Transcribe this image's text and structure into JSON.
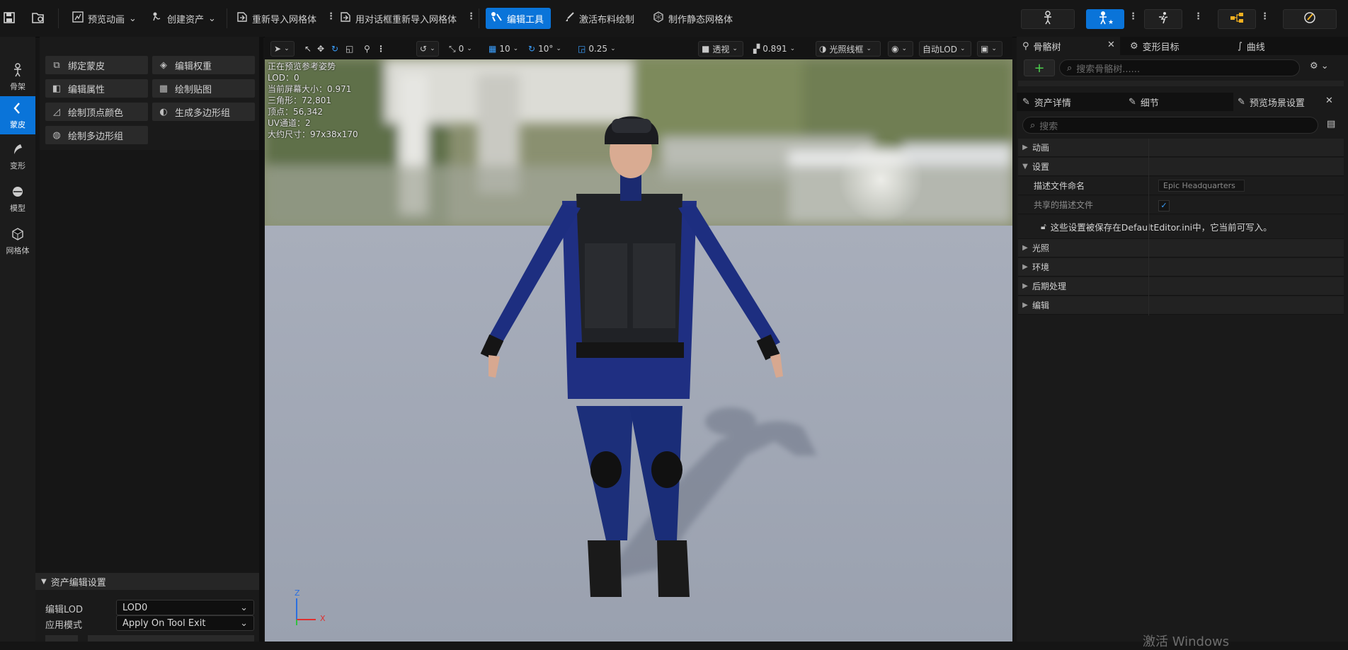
{
  "toolbar": {
    "preview_anim": "预览动画",
    "create_asset": "创建资产",
    "reimport_mesh": "重新导入网格体",
    "reimport_dialog": "用对话框重新导入网格体",
    "edit_tools": "编辑工具",
    "activate_cloth": "激活布料绘制",
    "make_static_mesh": "制作静态网格体"
  },
  "modes": [
    {
      "label": "骨架",
      "icon": "skeleton-icon"
    },
    {
      "label": "蒙皮",
      "icon": "skin-icon"
    },
    {
      "label": "变形",
      "icon": "deform-icon"
    },
    {
      "label": "模型",
      "icon": "model-icon"
    },
    {
      "label": "网格体",
      "icon": "mesh-icon"
    }
  ],
  "tools": [
    {
      "label": "绑定蒙皮",
      "icon": "bind-skin-icon"
    },
    {
      "label": "编辑权重",
      "icon": "edit-weights-icon"
    },
    {
      "label": "编辑属性",
      "icon": "edit-attributes-icon"
    },
    {
      "label": "绘制贴图",
      "icon": "paint-maps-icon"
    },
    {
      "label": "绘制顶点颜色",
      "icon": "paint-vertex-color-icon"
    },
    {
      "label": "生成多边形组",
      "icon": "generate-polygroups-icon"
    },
    {
      "label": "绘制多边形组",
      "icon": "paint-polygroups-icon"
    }
  ],
  "asset_settings": {
    "title": "资产编辑设置",
    "edit_lod_label": "编辑LOD",
    "edit_lod_value": "LOD0",
    "apply_mode_label": "应用模式",
    "apply_mode_value": "Apply On Tool Exit"
  },
  "viewport_toolbar": {
    "snap_rot": "0",
    "grid": "10",
    "rot_snap": "10°",
    "scale_snap": "0.25",
    "perspective": "透视",
    "camera_speed": "0.891",
    "view_mode": "光照线框",
    "lod": "自动LOD"
  },
  "stats": [
    "正在预览参考姿势",
    "LOD：0",
    "当前屏幕大小：0.971",
    "三角形：72,801",
    "顶点：56,342",
    "UV通道：2",
    "大约尺寸：97x38x170"
  ],
  "axes": {
    "z": "Z",
    "x": "X"
  },
  "right_panel": {
    "tabs_top": [
      "骨骼树",
      "变形目标",
      "曲线"
    ],
    "skeleton_search_placeholder": "搜索骨骼树......",
    "tabs_mid": [
      "资产详情",
      "细节",
      "预览场景设置"
    ],
    "search_placeholder": "搜索",
    "sections": [
      "动画",
      "设置",
      "光照",
      "环境",
      "后期处理",
      "编辑"
    ],
    "profile_name_label": "描述文件命名",
    "profile_name_value": "Epic Headquarters",
    "shared_profile_label": "共享的描述文件",
    "info_text": "这些设置被保存在DefaultEditor.ini中，它当前可写入。"
  },
  "watermark": "激活 Windows",
  "colors": {
    "accent": "#0a74d9",
    "panel": "#1a1a1a",
    "background": "#151515"
  }
}
